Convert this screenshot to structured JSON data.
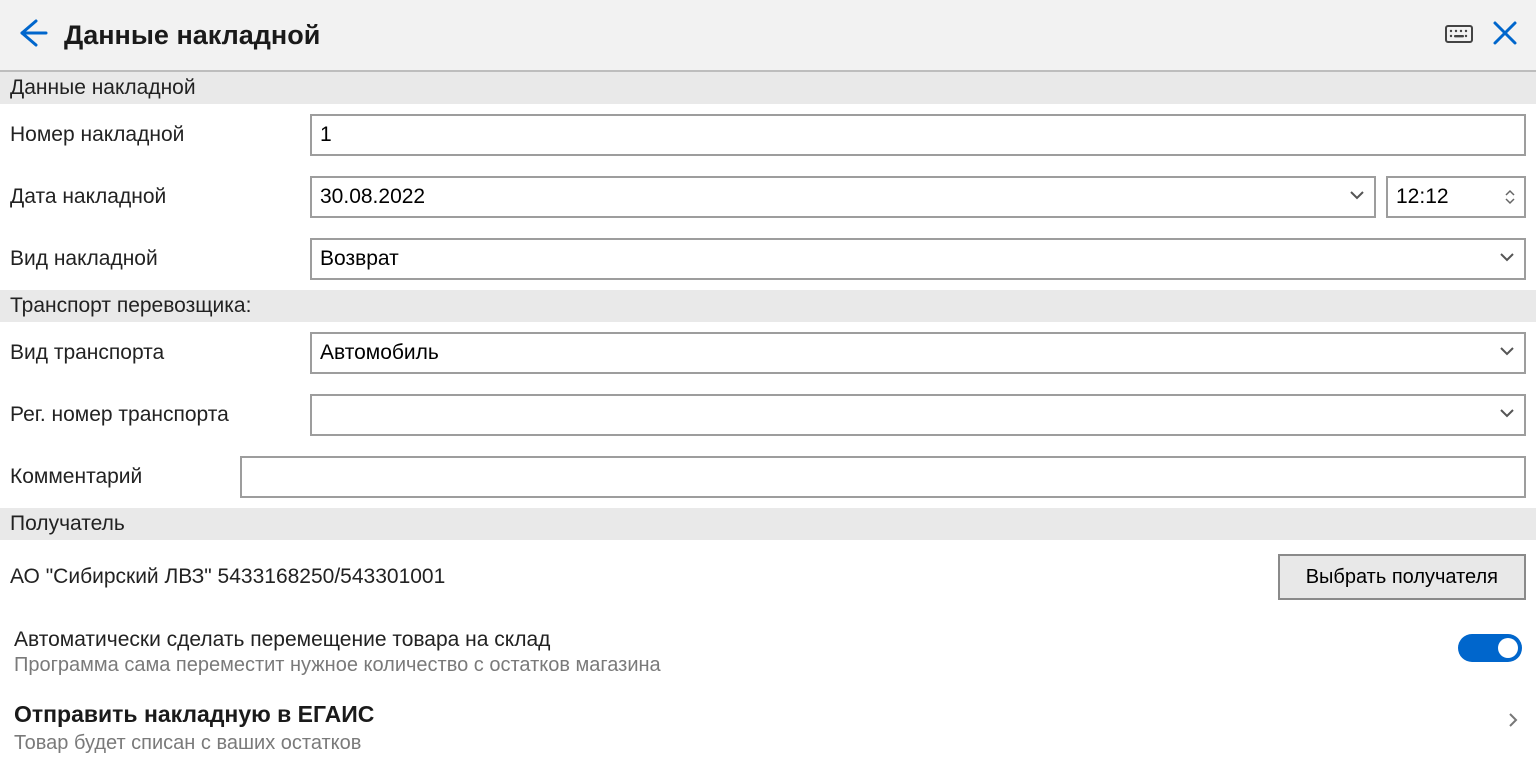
{
  "header": {
    "title": "Данные накладной"
  },
  "sections": {
    "invoice": "Данные накладной",
    "transport": "Транспорт перевозщика:",
    "recipient": "Получатель"
  },
  "labels": {
    "number": "Номер накладной",
    "date": "Дата накладной",
    "type": "Вид накладной",
    "transport_type": "Вид транспорта",
    "transport_reg": "Рег. номер транспорта",
    "comment": "Комментарий"
  },
  "values": {
    "number": "1",
    "date": "30.08.2022",
    "time": "12:12",
    "type": "Возврат",
    "transport_type": "Автомобиль",
    "transport_reg": "",
    "comment": ""
  },
  "recipient": {
    "value": "АО \"Сибирский ЛВЗ\" 5433168250/543301001",
    "choose_button": "Выбрать получателя"
  },
  "auto_move": {
    "title": "Автоматически сделать перемещение товара на склад",
    "subtitle": "Программа сама переместит нужное количество с остатков магазина",
    "on": true
  },
  "send": {
    "title": "Отправить накладную в ЕГАИС",
    "subtitle": "Товар будет списан с ваших остатков"
  },
  "colors": {
    "accent": "#0066cc"
  }
}
